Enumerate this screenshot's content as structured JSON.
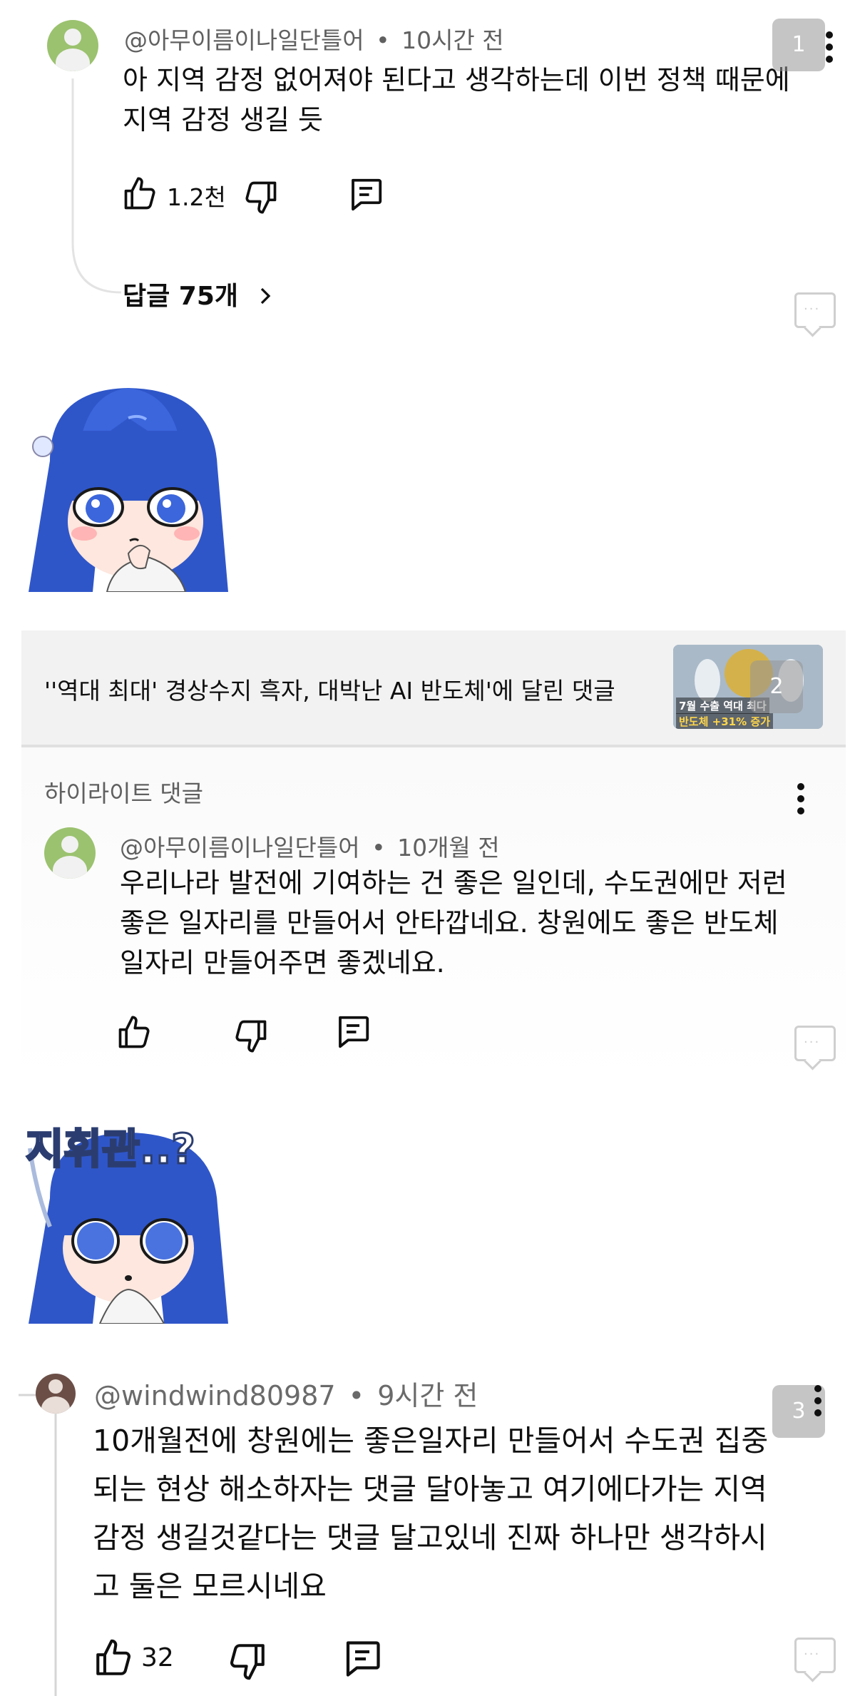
{
  "comment1": {
    "author": "@아무이름이나일단틀어",
    "separator": "•",
    "time": "10시간 전",
    "text_line1": "아 지역 감정 없어져야 된다고 생각하는데 이번 정책 때문에",
    "text_line2": "지역 감정 생길 듯",
    "likes": "1.2천",
    "replies_label": "답글 75개",
    "badge": "1"
  },
  "video_card": {
    "title": "''역대 최대' 경상수지 흑자, 대박난 AI 반도체'에 달린 댓글",
    "thumb_line1": "7월 수출 역대 최다",
    "thumb_line2": "반도체 +31% 증가",
    "badge": "2"
  },
  "highlight": {
    "section_label": "하이라이트 댓글",
    "author": "@아무이름이나일단틀어",
    "separator": "•",
    "time": "10개월 전",
    "text_line1": "우리나라 발전에 기여하는 건 좋은 일인데, 수도권에만 저런",
    "text_line2": "좋은 일자리를 만들어서 안타깝네요. 창원에도 좋은 반도체",
    "text_line3": "일자리 만들어주면 좋겠네요."
  },
  "sticker2": {
    "caption": "지휘관..?"
  },
  "comment3": {
    "author": "@windwind80987",
    "separator": "•",
    "time": "9시간 전",
    "text_line1": "10개월전에 창원에는 좋은일자리 만들어서 수도권 집중",
    "text_line2": "되는 현상 해소하자는 댓글 달아놓고 여기에다가는 지역",
    "text_line3": "감정 생길것같다는 댓글 달고있네 진짜 하나만 생각하시",
    "text_line4": "고 둘은 모르시네요",
    "likes": "32",
    "badge": "3"
  },
  "colors": {
    "avatar_green": "#9bc26f",
    "sticker_hair": "#2f56c9",
    "card_bg": "#f2f2f2"
  },
  "icons": [
    "thumbs-up-icon",
    "thumbs-down-icon",
    "reply-icon",
    "more-vert-icon",
    "chevron-right-icon",
    "chat-bubble-icon"
  ]
}
